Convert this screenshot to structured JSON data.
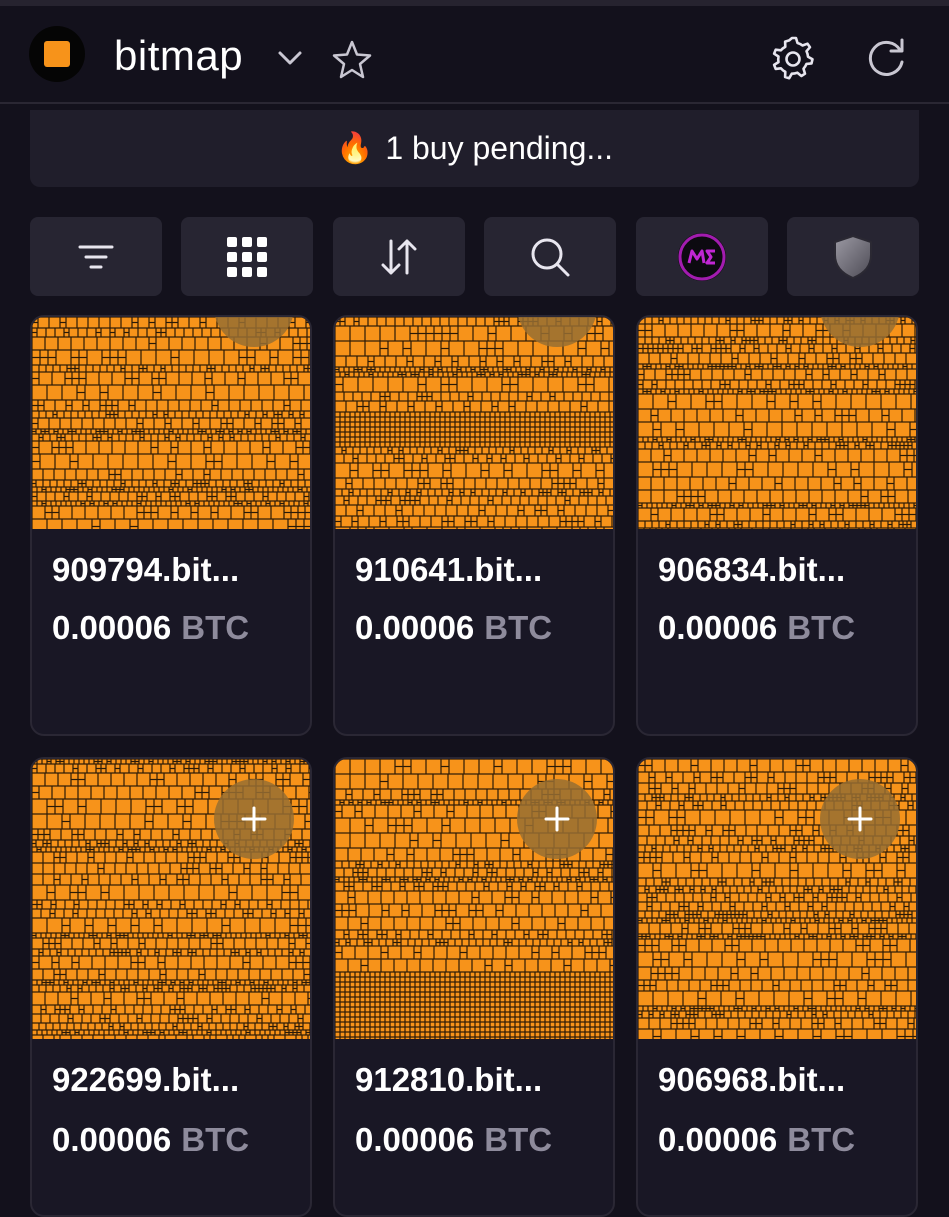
{
  "header": {
    "title": "bitmap",
    "logo_icon": "orange-square-logo",
    "dropdown_icon": "chevron-down-icon",
    "favorite_icon": "star-icon",
    "settings_icon": "gear-icon",
    "refresh_icon": "refresh-icon"
  },
  "pending": {
    "icon": "🔥",
    "text": "1 buy pending..."
  },
  "toolbar": [
    {
      "icon": "filter-icon"
    },
    {
      "icon": "grid-icon"
    },
    {
      "icon": "sort-icon"
    },
    {
      "icon": "search-icon"
    },
    {
      "icon": "magic-eden-icon"
    },
    {
      "icon": "shield-icon"
    }
  ],
  "cards": [
    {
      "name": "909794.bit...",
      "price": "0.00006",
      "unit": "BTC"
    },
    {
      "name": "910641.bit...",
      "price": "0.00006",
      "unit": "BTC"
    },
    {
      "name": "906834.bit...",
      "price": "0.00006",
      "unit": "BTC"
    },
    {
      "name": "922699.bit...",
      "price": "0.00006",
      "unit": "BTC"
    },
    {
      "name": "912810.bit...",
      "price": "0.00006",
      "unit": "BTC"
    },
    {
      "name": "906968.bit...",
      "price": "0.00006",
      "unit": "BTC"
    }
  ],
  "colors": {
    "background": "#13111c",
    "bitcoin_orange": "#f7931a",
    "card": "#191725",
    "button": "#272532",
    "muted": "#8e8b9c"
  }
}
